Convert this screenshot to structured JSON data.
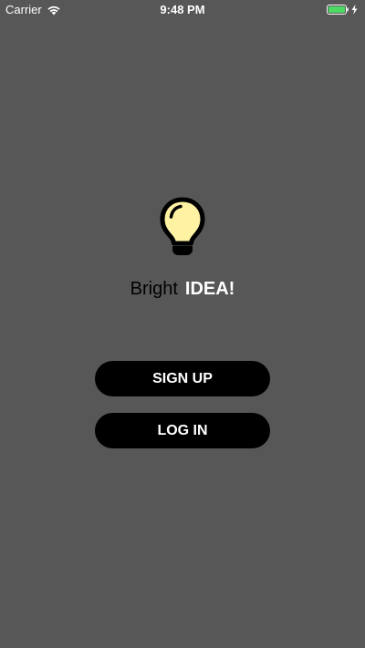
{
  "status_bar": {
    "carrier": "Carrier",
    "time": "9:48 PM",
    "wifi_icon": "wifi-icon",
    "battery_icon": "battery-icon",
    "charging_icon": "charging-bolt-icon",
    "battery_color": "#4cd964"
  },
  "brand": {
    "icon": "lightbulb-icon",
    "bulb_color": "#fff3a3",
    "word1": "Bright",
    "word2": "IDEA!"
  },
  "buttons": {
    "signup_label": "SIGN UP",
    "login_label": "LOG IN"
  },
  "colors": {
    "background": "#575757",
    "button_bg": "#000000",
    "button_text": "#ffffff"
  }
}
